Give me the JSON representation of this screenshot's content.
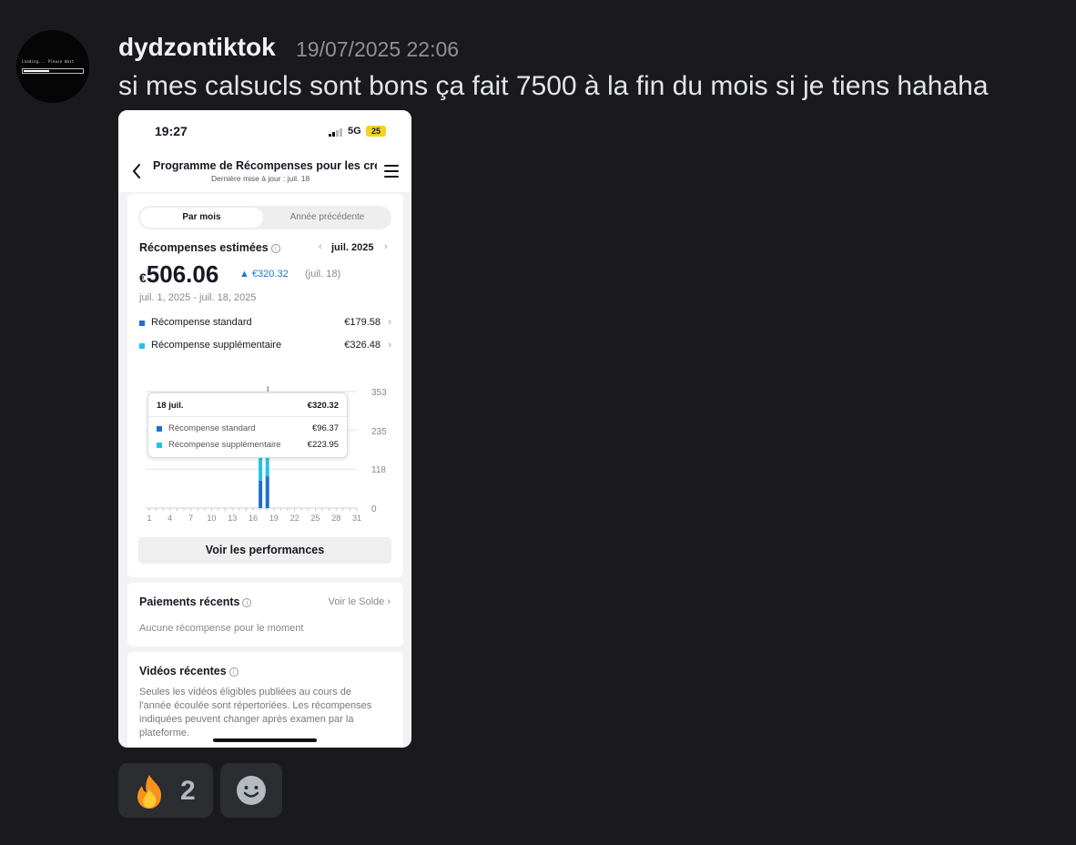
{
  "message": {
    "avatar_text": "Loading... Please Wait",
    "username": "dydzontiktok",
    "timestamp": "19/07/2025 22:06",
    "content": "si mes calsucls sont bons ça fait 7500 à la fin du mois si je tiens hahaha"
  },
  "phone": {
    "status": {
      "time": "19:27",
      "network": "5G",
      "battery": "25"
    },
    "header": {
      "title": "Programme de Récompenses pour les cré",
      "subtitle": "Dernière mise à jour : juil. 18"
    },
    "tabs": {
      "active": "Par mois",
      "inactive": "Année précédente"
    },
    "rewards": {
      "title": "Récompenses estimées",
      "month": "juil. 2025",
      "currency": "€",
      "total": "506.06",
      "delta": "▲ €320.32",
      "delta_date": "(juil. 18)",
      "date_range": "juil. 1, 2025 - juil. 18, 2025",
      "items": [
        {
          "label": "Récompense standard",
          "amount": "€179.58",
          "color": "#1f6fd1"
        },
        {
          "label": "Récompense supplémentaire",
          "amount": "€326.48",
          "color": "#22c3e6"
        }
      ]
    },
    "tooltip": {
      "date": "18 juil.",
      "total": "€320.32",
      "rows": [
        {
          "label": "Récompense standard",
          "amount": "€96.37"
        },
        {
          "label": "Récompense supplémentaire",
          "amount": "€223.95"
        }
      ]
    },
    "performance_button": "Voir les performances",
    "payments": {
      "title": "Paiements récents",
      "link": "Voir le Solde",
      "empty": "Aucune récompense pour le moment"
    },
    "videos": {
      "title": "Vidéos récentes",
      "description": "Seules les vidéos éligibles publiées au cours de l'année écoulée sont répertoriées. Les récompenses indiquées peuvent changer après examen par la plateforme."
    }
  },
  "chart_data": {
    "type": "bar",
    "stacked": true,
    "x_ticks": [
      "1",
      "4",
      "7",
      "10",
      "13",
      "16",
      "19",
      "22",
      "25",
      "28",
      "31"
    ],
    "y_ticks": [
      "353",
      "235",
      "118",
      "0"
    ],
    "ylim": [
      0,
      353
    ],
    "series": [
      {
        "name": "Récompense standard",
        "color": "#1f6fd1",
        "points": [
          {
            "day": 17,
            "value": 83.21
          },
          {
            "day": 18,
            "value": 96.37
          }
        ]
      },
      {
        "name": "Récompense supplémentaire",
        "color": "#22c3e6",
        "points": [
          {
            "day": 17,
            "value": 102.53
          },
          {
            "day": 18,
            "value": 223.95
          }
        ]
      }
    ],
    "selected_day": 18
  },
  "reactions": [
    {
      "icon": "fire-icon",
      "count": "2"
    }
  ],
  "info_glyph": "i",
  "chevron": "›",
  "chevron_left": "‹"
}
